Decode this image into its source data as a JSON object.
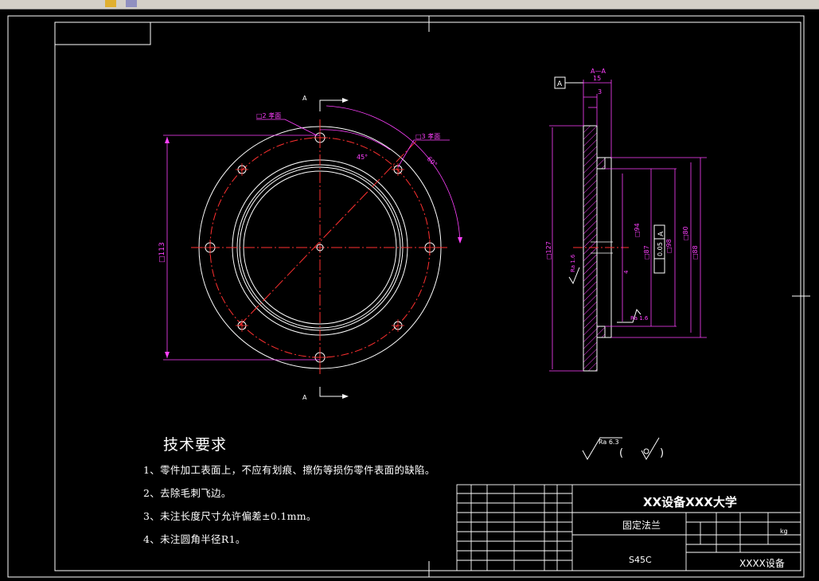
{
  "colors": {
    "background": "#000000",
    "frame": "#ffffff",
    "part_outline": "#ffffff",
    "centerline": "#ff3030",
    "dimension": "#ff40ff",
    "hatch": "#ff40ff"
  },
  "front_view": {
    "section_marks": [
      "A",
      "A"
    ],
    "dim_diameter": "□113",
    "angle_45": "45°",
    "angle_60": "60°",
    "hole_note_left": "□2 孝面",
    "hole_note_right": "□3 孝面"
  },
  "section_view": {
    "section_label": "A—A",
    "datum_box": "A",
    "dim_top_15": "15",
    "dim_top_3": "3",
    "dim_left_127": "□127",
    "dim_bore_94": "□94",
    "dim_bore_87": "□87",
    "dim_98": "□98",
    "dim_80": "□80",
    "dim_88": "□88",
    "tolerance_value": "0.05",
    "tolerance_datum": "A",
    "roughness_left": "Ra 1.6",
    "roughness_right": "Ra 1.6",
    "dim_4": "4"
  },
  "surface_finish_note": {
    "symbol_label": "Ra 6.3",
    "paren_open": "(",
    "paren_close": ")"
  },
  "technical_requirements": {
    "title": "技术要求",
    "items": [
      "1、零件加工表面上，不应有划痕、擦伤等损伤零件表面的缺陷。",
      "2、去除毛刺飞边。",
      "3、未注长度尺寸允许偏差±0.1mm。",
      "4、未注圆角半径R1。"
    ]
  },
  "title_block": {
    "school": "XX设备XXX大学",
    "part_name": "固定法兰",
    "material": "S45C",
    "company": "XXXX设备",
    "unit": "kg"
  }
}
